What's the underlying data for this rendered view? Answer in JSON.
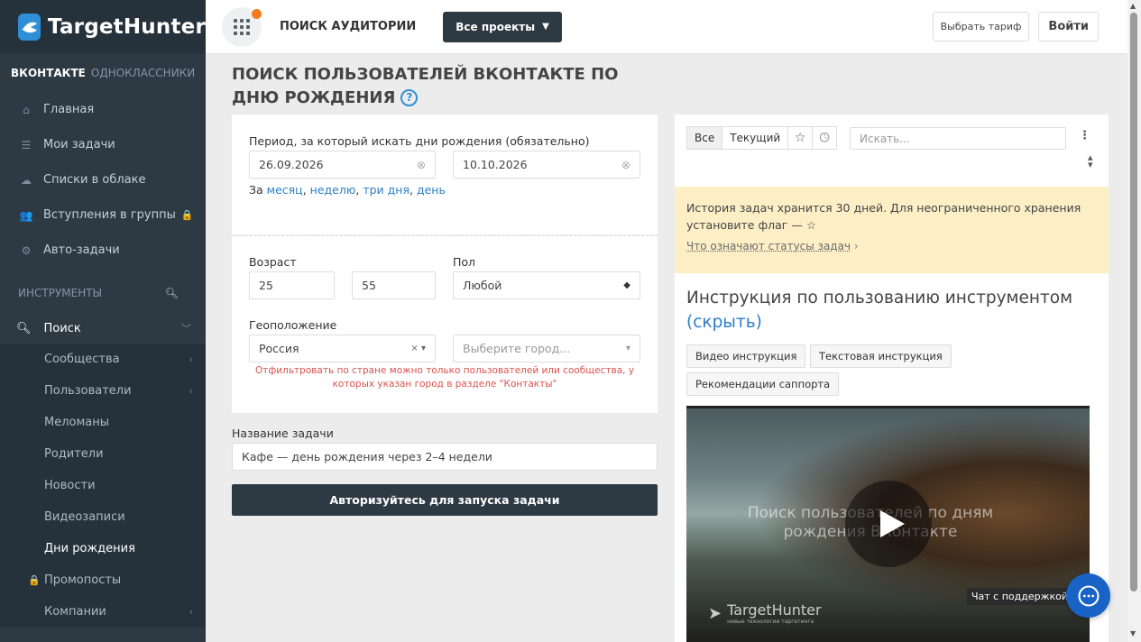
{
  "app": {
    "logo_text": "TargetHunter",
    "brand_color": "#2f8fd6",
    "sidebar_bg": "#2d3a44"
  },
  "sidebar": {
    "network_active": "ВКОНТАКТЕ",
    "network_inactive": "ОДНОКЛАССНИКИ",
    "items": [
      {
        "label": "Главная",
        "icon": "home-icon"
      },
      {
        "label": "Мои задачи",
        "icon": "list-icon"
      },
      {
        "label": "Списки в облаке",
        "icon": "cloud-icon"
      },
      {
        "label": "Вступления в группы",
        "icon": "users-icon"
      },
      {
        "label": "Авто-задачи",
        "icon": "gears-icon"
      }
    ],
    "tools_section": "ИНСТРУМЕНТЫ",
    "search_label": "Поиск",
    "sub_items": [
      {
        "label": "Сообщества"
      },
      {
        "label": "Пользователи"
      },
      {
        "label": "Меломаны"
      },
      {
        "label": "Родители"
      },
      {
        "label": "Новости"
      },
      {
        "label": "Видеозаписи"
      },
      {
        "label": "Дни рождения"
      },
      {
        "label": "Промопосты"
      },
      {
        "label": "Компании"
      }
    ]
  },
  "topbar": {
    "title": "ПОИСК АУДИТОРИИ",
    "projects_label": "Все проекты",
    "tariff_label": "Выбрать тариф",
    "login_label": "Войти"
  },
  "page": {
    "title": "ПОИСК ПОЛЬЗОВАТЕЛЕЙ ВКОНТАКТЕ ПО ДНЮ РОЖДЕНИЯ"
  },
  "form": {
    "period_label": "Период, за который искать дни рождения (обязательно)",
    "date_from": "26.09.2026",
    "date_to": "10.10.2026",
    "quick_prefix": "За",
    "quick_links": [
      "месяц",
      "неделю",
      "три дня",
      "день"
    ],
    "age_label": "Возраст",
    "age_from": "25",
    "age_to": "55",
    "gender_label": "Пол",
    "gender_value": "Любой",
    "geo_label": "Геоположение",
    "country_value": "Россия",
    "city_placeholder": "Выберите город...",
    "geo_hint": "Отфильтровать по стране можно только пользователей или сообщества, у которых указан город в разделе \"Контакты\"",
    "task_name_label": "Название задачи",
    "task_name_value": "Кафе — день рождения через 2–4 недели",
    "run_button": "Авторизуйтесь для запуска задачи"
  },
  "panel": {
    "tab_all": "Все",
    "tab_current": "Текущий",
    "search_placeholder": "Искать...",
    "notice_text": "История задач хранится 30 дней. Для неограниченного хранения установите флаг — ☆",
    "notice_link": "Что означают статусы задач",
    "instr_title": "Инструкция по пользованию инструментом",
    "instr_hide": "(скрыть)",
    "chip_video": "Видео инструкция",
    "chip_text": "Текстовая инструкция",
    "chip_support": "Рекомендации саппорта",
    "video_caption": "Поиск пользователей по дням рождения ВКонтакте",
    "video_logo": "TargetHunter",
    "video_logo_sub": "новые технологии таргетинга"
  },
  "chat": {
    "label": "Чат с поддержкой"
  }
}
